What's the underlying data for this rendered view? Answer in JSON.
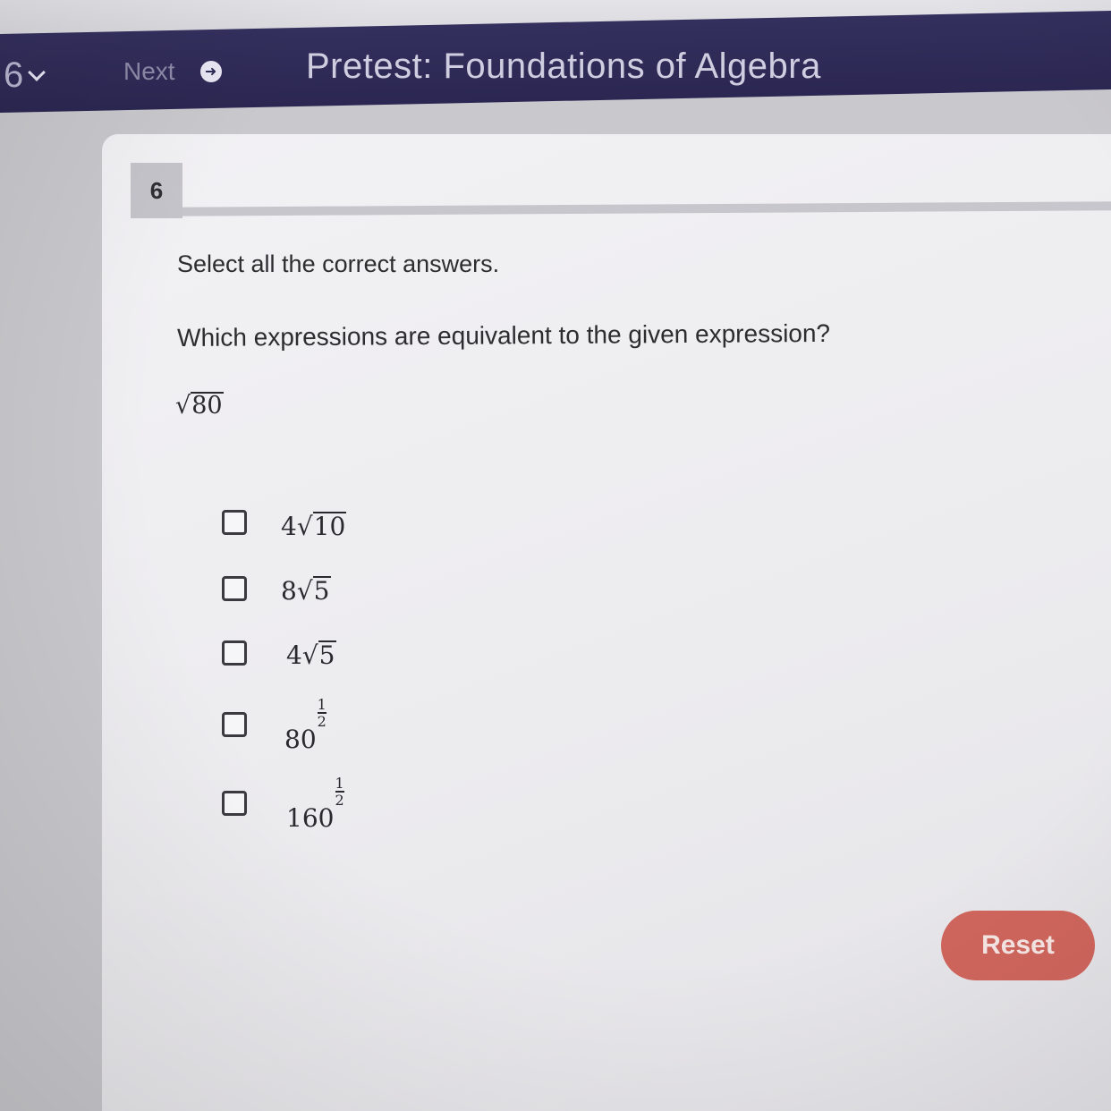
{
  "nav": {
    "question_selector": "6",
    "next_label": "Next",
    "title": "Pretest: Foundations of Algebra"
  },
  "question": {
    "number": "6",
    "instruction": "Select all the correct answers.",
    "prompt": "Which expressions are equivalent to the given expression?",
    "given_radicand": "80"
  },
  "options": [
    {
      "coefficient": "4",
      "radicand": "10",
      "checked": false
    },
    {
      "coefficient": "8",
      "radicand": "5",
      "checked": false
    },
    {
      "coefficient": "4",
      "radicand": "5",
      "checked": false
    },
    {
      "base": "80",
      "exp_num": "1",
      "exp_den": "2",
      "checked": false
    },
    {
      "base": "160",
      "exp_num": "1",
      "exp_den": "2",
      "checked": false
    }
  ],
  "reset_label": "Reset",
  "colors": {
    "nav_bg": "#2e2a57",
    "reset_bg": "#d0665d",
    "card_bg": "#efeef1"
  },
  "icons": {
    "selector": "chevron-down-icon",
    "next": "arrow-right-circle-icon"
  }
}
